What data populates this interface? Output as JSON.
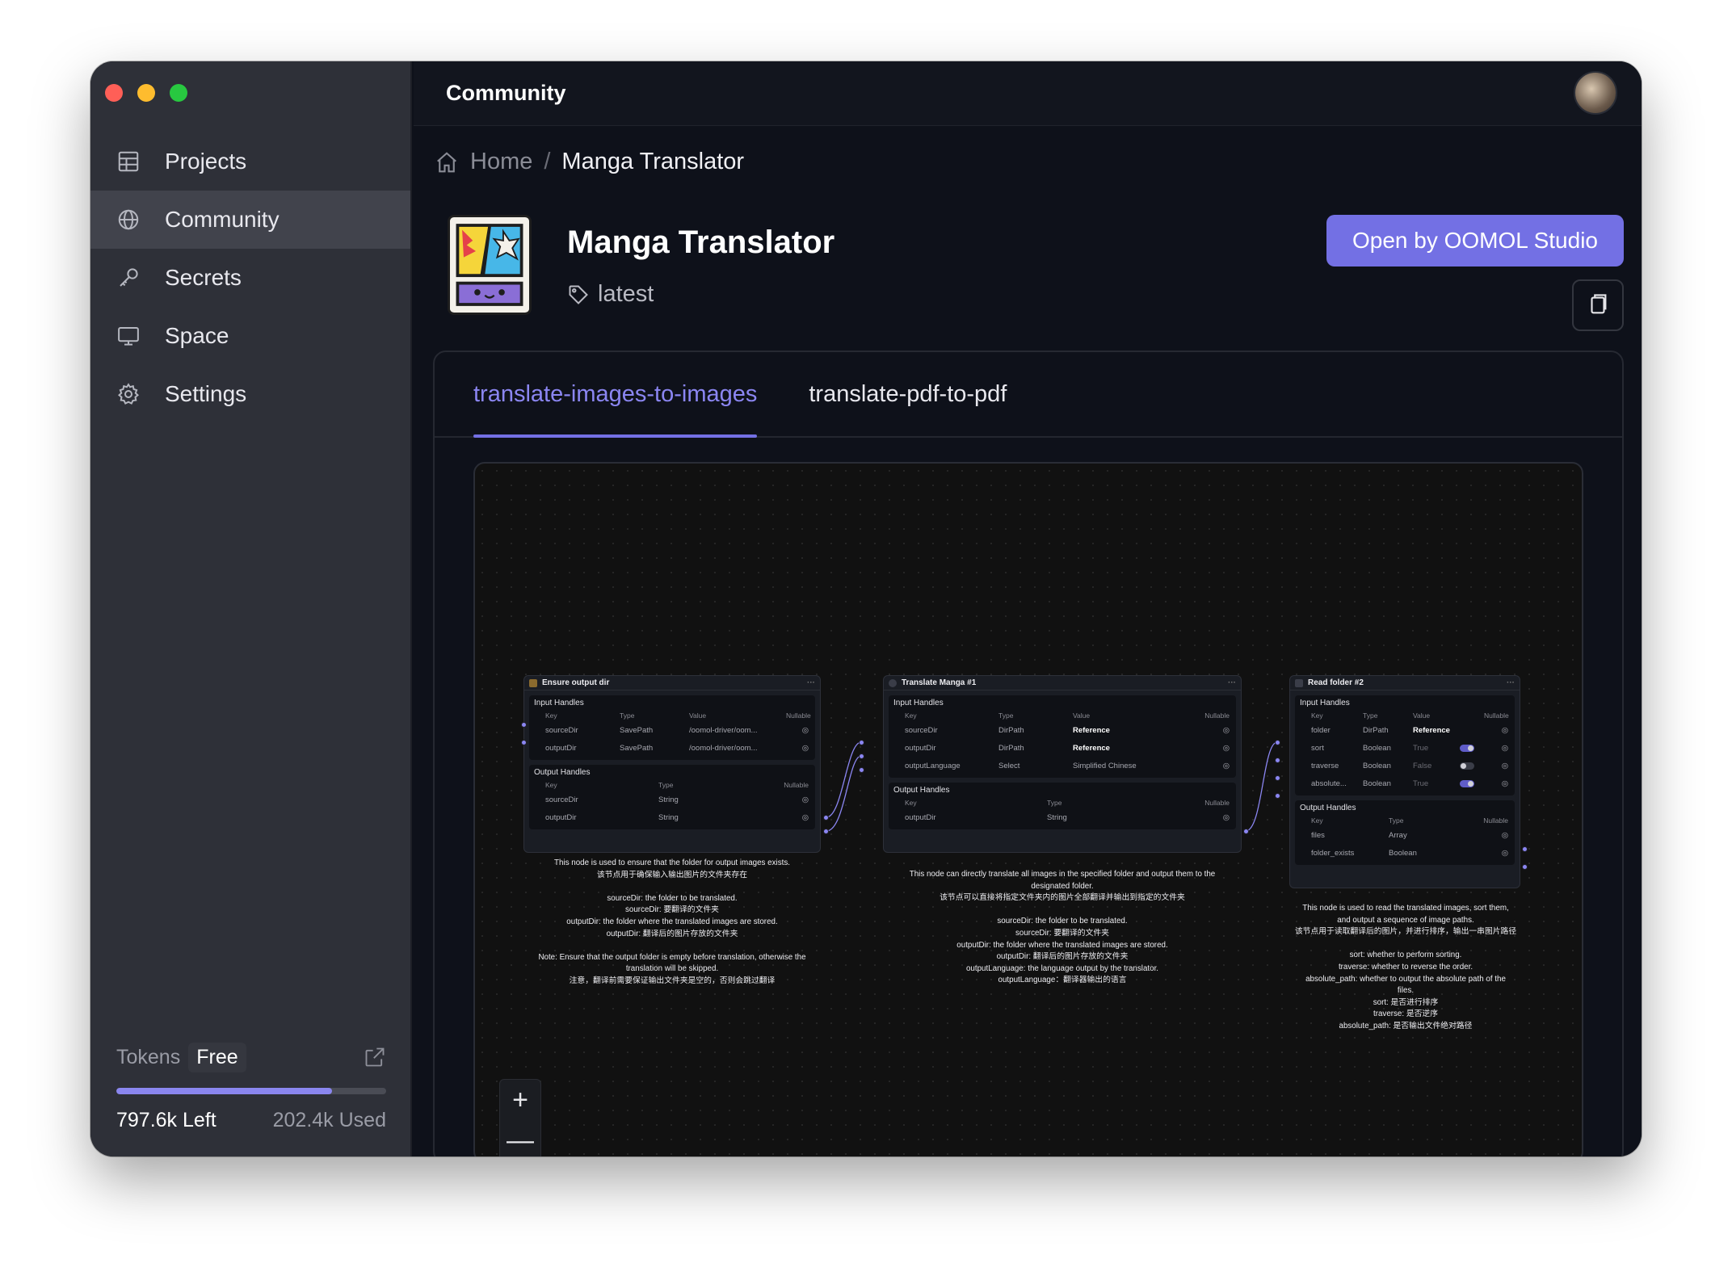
{
  "window": {
    "title": "Community"
  },
  "sidebar": {
    "items": [
      {
        "label": "Projects",
        "icon": "grid-icon",
        "active": false
      },
      {
        "label": "Community",
        "icon": "globe-icon",
        "active": true
      },
      {
        "label": "Secrets",
        "icon": "key-icon",
        "active": false
      },
      {
        "label": "Space",
        "icon": "monitor-icon",
        "active": false
      },
      {
        "label": "Settings",
        "icon": "gear-icon",
        "active": false
      }
    ],
    "tokens": {
      "label": "Tokens",
      "plan": "Free",
      "left": "797.6k Left",
      "used": "202.4k Used",
      "left_fraction": 0.798
    }
  },
  "breadcrumb": {
    "home": "Home",
    "separator": "/",
    "current": "Manga Translator"
  },
  "app": {
    "title": "Manga Translator",
    "version": "latest",
    "open_button": "Open by OOMOL Studio",
    "accent_color": "#7370e4"
  },
  "tabs": [
    {
      "label": "translate-images-to-images",
      "active": true
    },
    {
      "label": "translate-pdf-to-pdf",
      "active": false
    }
  ],
  "workflow": {
    "zoom_in": "+",
    "zoom_out": "—",
    "col": {
      "key": "Key",
      "type": "Type",
      "value": "Value",
      "nullable": "Nullable"
    },
    "nodes": [
      {
        "title": "Ensure output dir",
        "input_label": "Input Handles",
        "inputs": [
          {
            "key": "sourceDir",
            "type": "SavePath",
            "value": "/oomol-driver/oom..."
          },
          {
            "key": "outputDir",
            "type": "SavePath",
            "value": "/oomol-driver/oom..."
          }
        ],
        "output_label": "Output Handles",
        "outputs": [
          {
            "key": "sourceDir",
            "type": "String"
          },
          {
            "key": "outputDir",
            "type": "String"
          }
        ],
        "description": "This node is used to ensure that the folder for output images exists.\n该节点用于确保输入输出图片的文件夹存在\n\nsourceDir: the folder to be translated.\nsourceDir: 要翻译的文件夹\noutputDir: the folder where the translated images are stored.\noutputDir: 翻译后的图片存放的文件夹\n\nNote: Ensure that the output folder is empty before translation, otherwise the\ntranslation will be skipped.\n注意，翻译前需要保证输出文件夹是空的，否则会跳过翻译"
      },
      {
        "title": "Translate Manga #1",
        "input_label": "Input Handles",
        "inputs": [
          {
            "key": "sourceDir",
            "type": "DirPath",
            "value": "Reference"
          },
          {
            "key": "outputDir",
            "type": "DirPath",
            "value": "Reference"
          },
          {
            "key": "outputLanguage",
            "type": "Select",
            "value": "Simplified Chinese"
          }
        ],
        "output_label": "Output Handles",
        "outputs": [
          {
            "key": "outputDir",
            "type": "String"
          }
        ],
        "description": "This node can directly translate all images in the specified folder and output them to the\ndesignated folder.\n该节点可以直接将指定文件夹内的图片全部翻译并输出到指定的文件夹\n\nsourceDir: the folder to be translated.\nsourceDir: 要翻译的文件夹\noutputDir: the folder where the translated images are stored.\noutputDir: 翻译后的图片存放的文件夹\noutputLanguage: the language output by the translator.\noutputLanguage：翻译器输出的语言"
      },
      {
        "title": "Read folder #2",
        "input_label": "Input Handles",
        "inputs": [
          {
            "key": "folder",
            "type": "DirPath",
            "value": "Reference"
          },
          {
            "key": "sort",
            "type": "Boolean",
            "value": "True"
          },
          {
            "key": "traverse",
            "type": "Boolean",
            "value": "False"
          },
          {
            "key": "absolute...",
            "type": "Boolean",
            "value": "True"
          }
        ],
        "output_label": "Output Handles",
        "outputs": [
          {
            "key": "files",
            "type": "Array"
          },
          {
            "key": "folder_exists",
            "type": "Boolean"
          }
        ],
        "description": "This node is used to read the translated images, sort them,\nand output a sequence of image paths.\n该节点用于读取翻译后的图片，并进行排序，输出一串图片路径\n\nsort: whether to perform sorting.\ntraverse: whether to reverse the order.\nabsolute_path: whether to output the absolute path of the\nfiles.\nsort: 是否进行排序\ntraverse: 是否逆序\nabsolute_path: 是否输出文件绝对路径"
      }
    ]
  }
}
